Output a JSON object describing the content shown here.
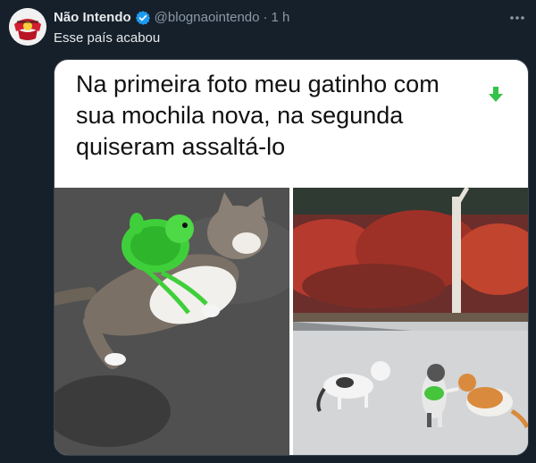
{
  "author": {
    "display_name": "Não Intendo",
    "handle": "@blognaointendo",
    "separator": "·",
    "time": "1 h",
    "avatar_icon": "nao-intendo-logo-icon",
    "verified_icon": "verified-badge-icon",
    "verified_color": "#1d9bf0"
  },
  "tweet": {
    "text": "Esse país acabou",
    "more_icon": "more-options-icon"
  },
  "media": {
    "caption": "Na primeira foto meu gatinho com sua mochila nova, na segunda quiseram assaltá-lo",
    "arrow_icon": "down-arrow-icon",
    "arrow_color": "#35c24a",
    "photo_left": "cat-with-turtle-backpack-photo",
    "photo_right": "cats-in-park-photo"
  },
  "colors": {
    "background": "#15202b",
    "text": "#e7e9ea",
    "muted": "#8b98a5"
  }
}
